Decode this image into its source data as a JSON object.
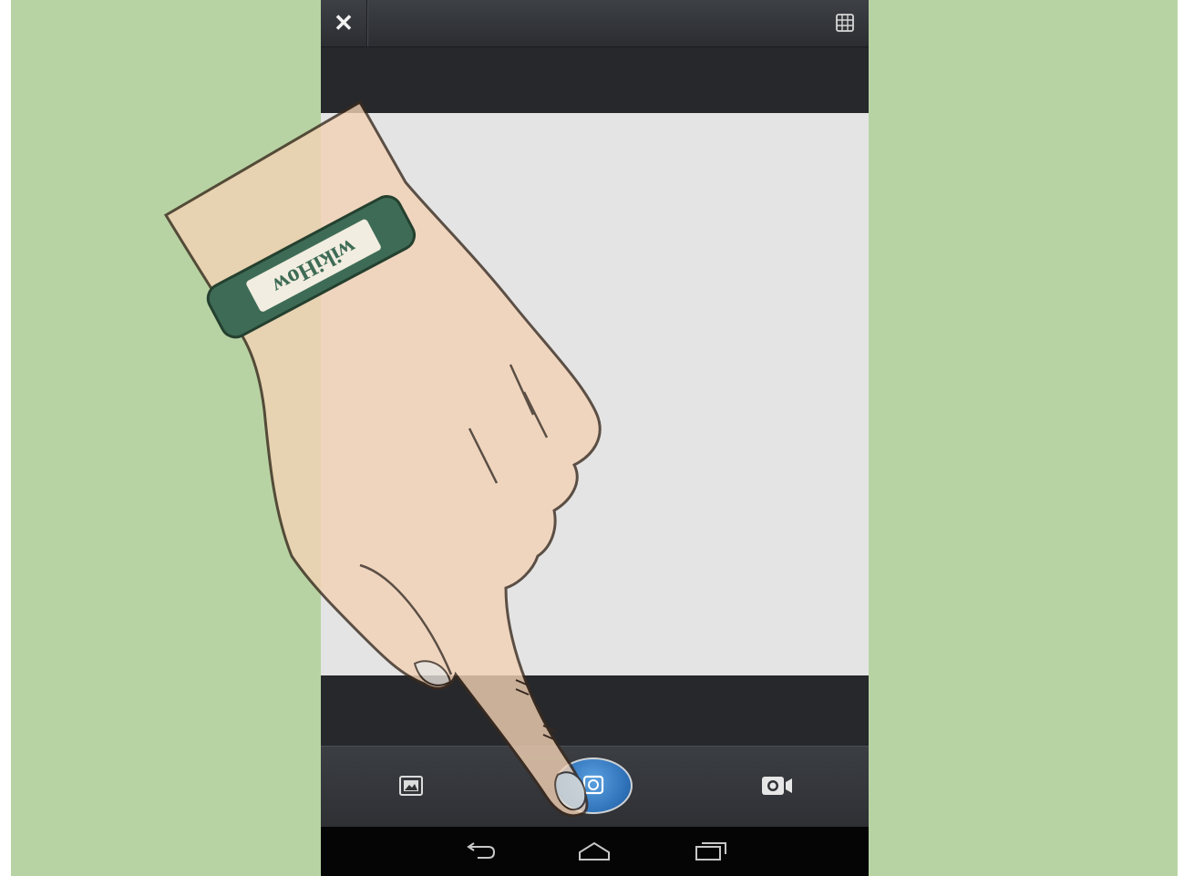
{
  "top_bar": {
    "close_glyph": "✕",
    "grid_icon": "grid-icon"
  },
  "controls": {
    "gallery_icon": "gallery-icon",
    "shutter_icon": "camera-shutter-icon",
    "video_icon": "video-camera-icon"
  },
  "nav": {
    "back_icon": "back-icon",
    "home_icon": "home-icon",
    "recents_icon": "recent-apps-icon"
  },
  "wristband": {
    "text": "wikiHow"
  },
  "colors": {
    "background": "#b8d3a3",
    "shutter_accent": "#2d6fb6",
    "wristband": "#3e6b55"
  }
}
